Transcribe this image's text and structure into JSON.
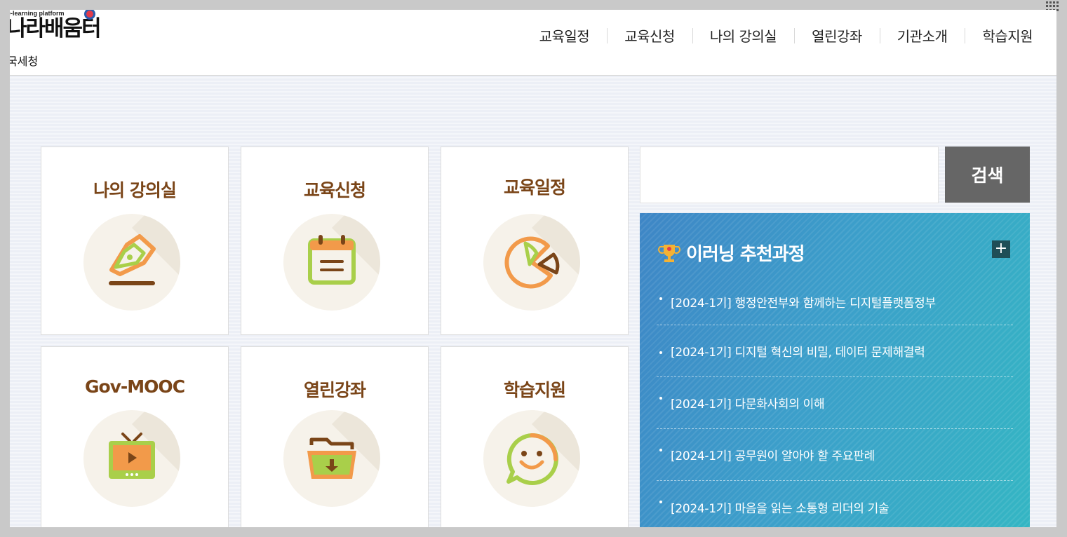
{
  "logo": {
    "small_text": "Government\ne-learning platform",
    "main_text": "나라배움터",
    "org_name": "국세청"
  },
  "nav": {
    "items": [
      "교육일정",
      "교육신청",
      "나의 강의실",
      "열린강좌",
      "기관소개",
      "학습지원"
    ]
  },
  "tiles": [
    {
      "title": "나의 강의실",
      "icon": "pen-nib-icon"
    },
    {
      "title": "교육신청",
      "icon": "calendar-icon"
    },
    {
      "title": "교육일정",
      "icon": "pie-chart-icon"
    },
    {
      "title": "Gov-MOOC",
      "icon": "tv-play-icon"
    },
    {
      "title": "열린강좌",
      "icon": "folder-download-icon"
    },
    {
      "title": "학습지원",
      "icon": "smile-chat-icon"
    }
  ],
  "search": {
    "placeholder": "",
    "button_label": "검색"
  },
  "recommend": {
    "title": "이러닝 추천과정",
    "more_label": "+",
    "items": [
      "[2024-1기] 행정안전부와 함께하는 디지털플랫폼정부",
      "[2024-1기] 디지털 혁신의 비밀, 데이터 문제해결력",
      "[2024-1기] 다문화사회의 이해",
      "[2024-1기] 공무원이 알아야 할 주요판례",
      "[2024-1기] 마음을 읽는 소통형 리더의 기술"
    ]
  },
  "colors": {
    "tile_title": "#7a4518",
    "panel_start": "#3e86c6",
    "panel_end": "#34b6c3",
    "search_button": "#666666",
    "icon_orange": "#f29a4a",
    "icon_green": "#a9cf4a",
    "icon_brown": "#7a4518"
  }
}
